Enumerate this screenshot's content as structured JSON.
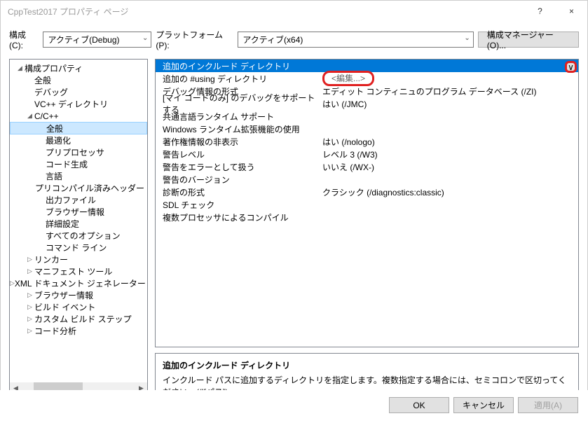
{
  "window": {
    "title": "CppTest2017 プロパティ ページ",
    "help": "?",
    "close": "×"
  },
  "toolbar": {
    "config_label": "構成(C):",
    "config_value": "アクティブ(Debug)",
    "platform_label": "プラットフォーム(P):",
    "platform_value": "アクティブ(x64)",
    "manager": "構成マネージャー(O)..."
  },
  "tree": {
    "root": "構成プロパティ",
    "items": [
      {
        "label": "全般",
        "indent": 2
      },
      {
        "label": "デバッグ",
        "indent": 2
      },
      {
        "label": "VC++ ディレクトリ",
        "indent": 2
      },
      {
        "label": "C/C++",
        "indent": 2,
        "expander": "◢"
      },
      {
        "label": "全般",
        "indent": 3,
        "selected": true
      },
      {
        "label": "最適化",
        "indent": 3
      },
      {
        "label": "プリプロセッサ",
        "indent": 3
      },
      {
        "label": "コード生成",
        "indent": 3
      },
      {
        "label": "言語",
        "indent": 3
      },
      {
        "label": "プリコンパイル済みヘッダー",
        "indent": 3
      },
      {
        "label": "出力ファイル",
        "indent": 3
      },
      {
        "label": "ブラウザー情報",
        "indent": 3
      },
      {
        "label": "詳細設定",
        "indent": 3
      },
      {
        "label": "すべてのオプション",
        "indent": 3
      },
      {
        "label": "コマンド ライン",
        "indent": 3
      },
      {
        "label": "リンカー",
        "indent": 2,
        "expander": "▷"
      },
      {
        "label": "マニフェスト ツール",
        "indent": 2,
        "expander": "▷"
      },
      {
        "label": "XML ドキュメント ジェネレーター",
        "indent": 2,
        "expander": "▷"
      },
      {
        "label": "ブラウザー情報",
        "indent": 2,
        "expander": "▷"
      },
      {
        "label": "ビルド イベント",
        "indent": 2,
        "expander": "▷"
      },
      {
        "label": "カスタム ビルド ステップ",
        "indent": 2,
        "expander": "▷"
      },
      {
        "label": "コード分析",
        "indent": 2,
        "expander": "▷"
      }
    ]
  },
  "grid": {
    "rows": [
      {
        "k": "追加のインクルード ディレクトリ",
        "v": "",
        "highlight": true
      },
      {
        "k": "追加の #using ディレクトリ",
        "v": "<編集...>",
        "edit": true
      },
      {
        "k": "デバッグ情報の形式",
        "v": "エディット コンティニュのプログラム データベース (/ZI)"
      },
      {
        "k": "[マイ コードのみ] のデバッグをサポートする",
        "v": "はい (/JMC)"
      },
      {
        "k": "共通言語ランタイム サポート",
        "v": ""
      },
      {
        "k": "Windows ランタイム拡張機能の使用",
        "v": ""
      },
      {
        "k": "著作権情報の非表示",
        "v": "はい (/nologo)"
      },
      {
        "k": "警告レベル",
        "v": "レベル 3 (/W3)"
      },
      {
        "k": "警告をエラーとして扱う",
        "v": "いいえ (/WX-)"
      },
      {
        "k": "警告のバージョン",
        "v": ""
      },
      {
        "k": "診断の形式",
        "v": "クラシック (/diagnostics:classic)"
      },
      {
        "k": "SDL チェック",
        "v": ""
      },
      {
        "k": "複数プロセッサによるコンパイル",
        "v": ""
      }
    ],
    "dropdown_glyph": "∨"
  },
  "desc": {
    "title": "追加のインクルード ディレクトリ",
    "body": "インクルード パスに追加するディレクトリを指定します。複数指定する場合には、セミコロンで区切ってください。(/I[パス])"
  },
  "footer": {
    "ok": "OK",
    "cancel": "キャンセル",
    "apply": "適用(A)"
  }
}
